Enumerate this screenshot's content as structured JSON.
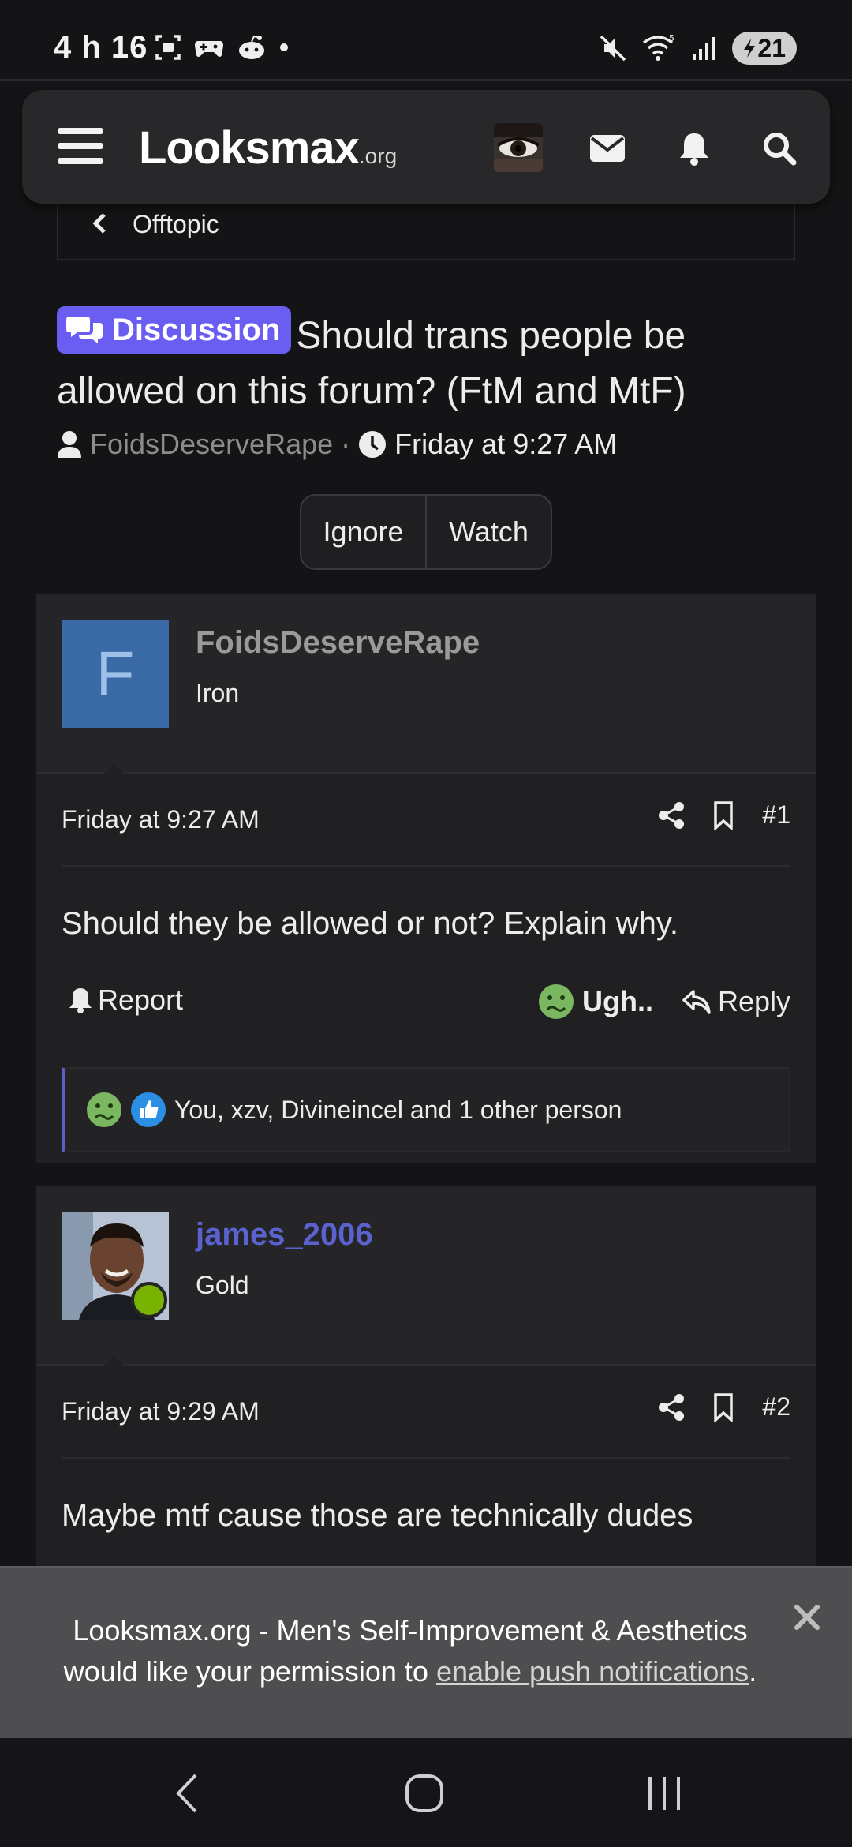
{
  "status_bar": {
    "time": "4 h 16",
    "battery": "21",
    "icons": [
      "screenshot-icon",
      "game-icon",
      "reddit-icon",
      "dot-icon",
      "mute-icon",
      "wifi-icon",
      "signal-icon",
      "battery-icon"
    ]
  },
  "header": {
    "logo_text": "Looksmax",
    "logo_suffix": ".org",
    "icons": [
      "menu-icon",
      "avatar",
      "mail-icon",
      "bell-icon",
      "search-icon"
    ]
  },
  "breadcrumb": {
    "label": "Offtopic"
  },
  "thread": {
    "prefix": "Discussion",
    "title": "Should trans people be allowed on this forum? (FtM and MtF)",
    "author": "FoidsDeserveRape",
    "separator": "·",
    "date": "Friday at 9:27 AM",
    "actions": {
      "ignore": "Ignore",
      "watch": "Watch"
    }
  },
  "posts": [
    {
      "avatar_letter": "F",
      "username": "FoidsDeserveRape",
      "user_title": "Iron",
      "date": "Friday at 9:27 AM",
      "number": "#1",
      "body": "Should they be allowed or not? Explain why.",
      "report_label": "Report",
      "reaction_label": "Ugh..",
      "reply_label": "Reply",
      "reactions_summary": "You, xzv, Divineincel and 1 other person"
    },
    {
      "username": "james_2006",
      "user_title": "Gold",
      "date": "Friday at 9:29 AM",
      "number": "#2",
      "body": "Maybe mtf cause those are technically dudes"
    }
  ],
  "push_notice": {
    "text_before": "Looksmax.org - Men's Self-Improvement & Aesthetics would like your permission to ",
    "link_text": "enable push notifications",
    "text_after": "."
  },
  "colors": {
    "accent_purple": "#6a5df2",
    "username_blue": "#5a62d0",
    "username_gray": "#9a9a9a",
    "online_green": "#77b300",
    "avatar_blue": "#3a6aa5"
  }
}
